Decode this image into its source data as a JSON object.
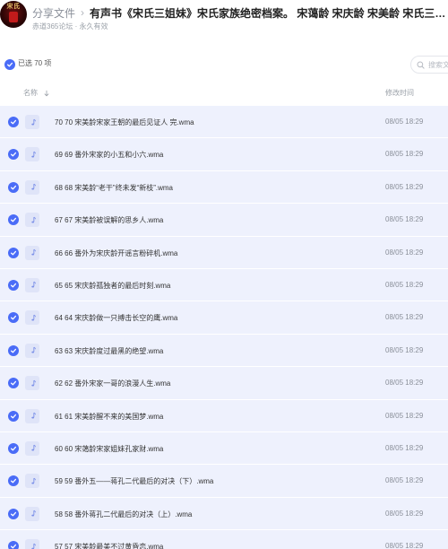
{
  "header": {
    "avatar_text": "宋氏",
    "crumb_root": "分享文件",
    "crumb_separator": "›",
    "title": "有声书《宋氏三姐妹》宋氏家族绝密档案。 宋蔼龄 宋庆龄 宋美龄 宋氏三姐妹的...",
    "subtitle": "赤道365论坛 · 永久有效"
  },
  "selection": {
    "label": "已选 70 项",
    "search_placeholder": "搜索文件"
  },
  "table": {
    "col_name": "名称",
    "col_time": "修改时间"
  },
  "files": [
    {
      "name": "70 70 宋美龄宋家王朝的最后见证人 完.wma",
      "time": "08/05 18:29"
    },
    {
      "name": "69 69 番外宋家的小五和小六.wma",
      "time": "08/05 18:29"
    },
    {
      "name": "68 68 宋美龄“老干”终未发“新枝”.wma",
      "time": "08/05 18:29"
    },
    {
      "name": "67 67 宋美龄被误解的思乡人.wma",
      "time": "08/05 18:29"
    },
    {
      "name": "66 66 番外为宋庆龄开谣言粉碎机.wma",
      "time": "08/05 18:29"
    },
    {
      "name": "65 65 宋庆龄孤独者的最后时刻.wma",
      "time": "08/05 18:29"
    },
    {
      "name": "64 64 宋庆龄做一只搏击长空的鹰.wma",
      "time": "08/05 18:29"
    },
    {
      "name": "63 63 宋庆龄度过最黑的绝望.wma",
      "time": "08/05 18:29"
    },
    {
      "name": "62 62 番外宋家一哥的浪漫人生.wma",
      "time": "08/05 18:29"
    },
    {
      "name": "61 61 宋美龄醒不来的美国梦.wma",
      "time": "08/05 18:29"
    },
    {
      "name": "60 60 宋蔼龄宋家姐妹孔家财.wma",
      "time": "08/05 18:29"
    },
    {
      "name": "59 59 番外五——蒋孔二代最后的对决（下）.wma",
      "time": "08/05 18:29"
    },
    {
      "name": "58 58 番外蒋孔二代最后的对决（上）.wma",
      "time": "08/05 18:29"
    },
    {
      "name": "57 57 宋美龄最美不过黄昏恋.wma",
      "time": "08/05 18:29"
    }
  ],
  "colors": {
    "accent": "#4a6cf7",
    "row_selected_bg": "#eef1fd"
  }
}
